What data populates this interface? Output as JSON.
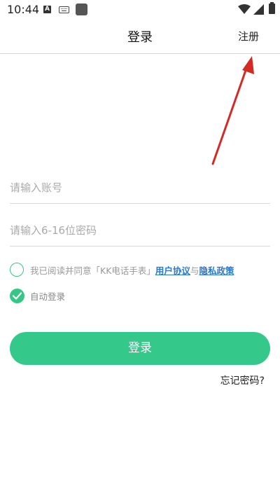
{
  "status": {
    "time": "10:44",
    "a_icon": "A"
  },
  "header": {
    "title": "登录",
    "register": "注册"
  },
  "form": {
    "account_placeholder": "请输入账号",
    "password_placeholder": "请输入6-16位密码"
  },
  "agreement": {
    "prefix": "我已阅读并同意「KK电话手表」",
    "user_agreement": "用户协议",
    "conjunction": "与",
    "privacy_policy": "隐私政策",
    "checked": false
  },
  "auto_login": {
    "label": "自动登录",
    "checked": true
  },
  "login_button": "登录",
  "forgot_password": "忘记密码?",
  "colors": {
    "accent": "#34c98a",
    "link": "#2a78d1",
    "arrow": "#d42a24"
  },
  "icons": [
    "a-notification-icon",
    "keyboard-icon",
    "app-square-icon",
    "wifi-icon",
    "signal-icon",
    "battery-icon",
    "checkmark-icon",
    "red-arrow-annotation"
  ]
}
